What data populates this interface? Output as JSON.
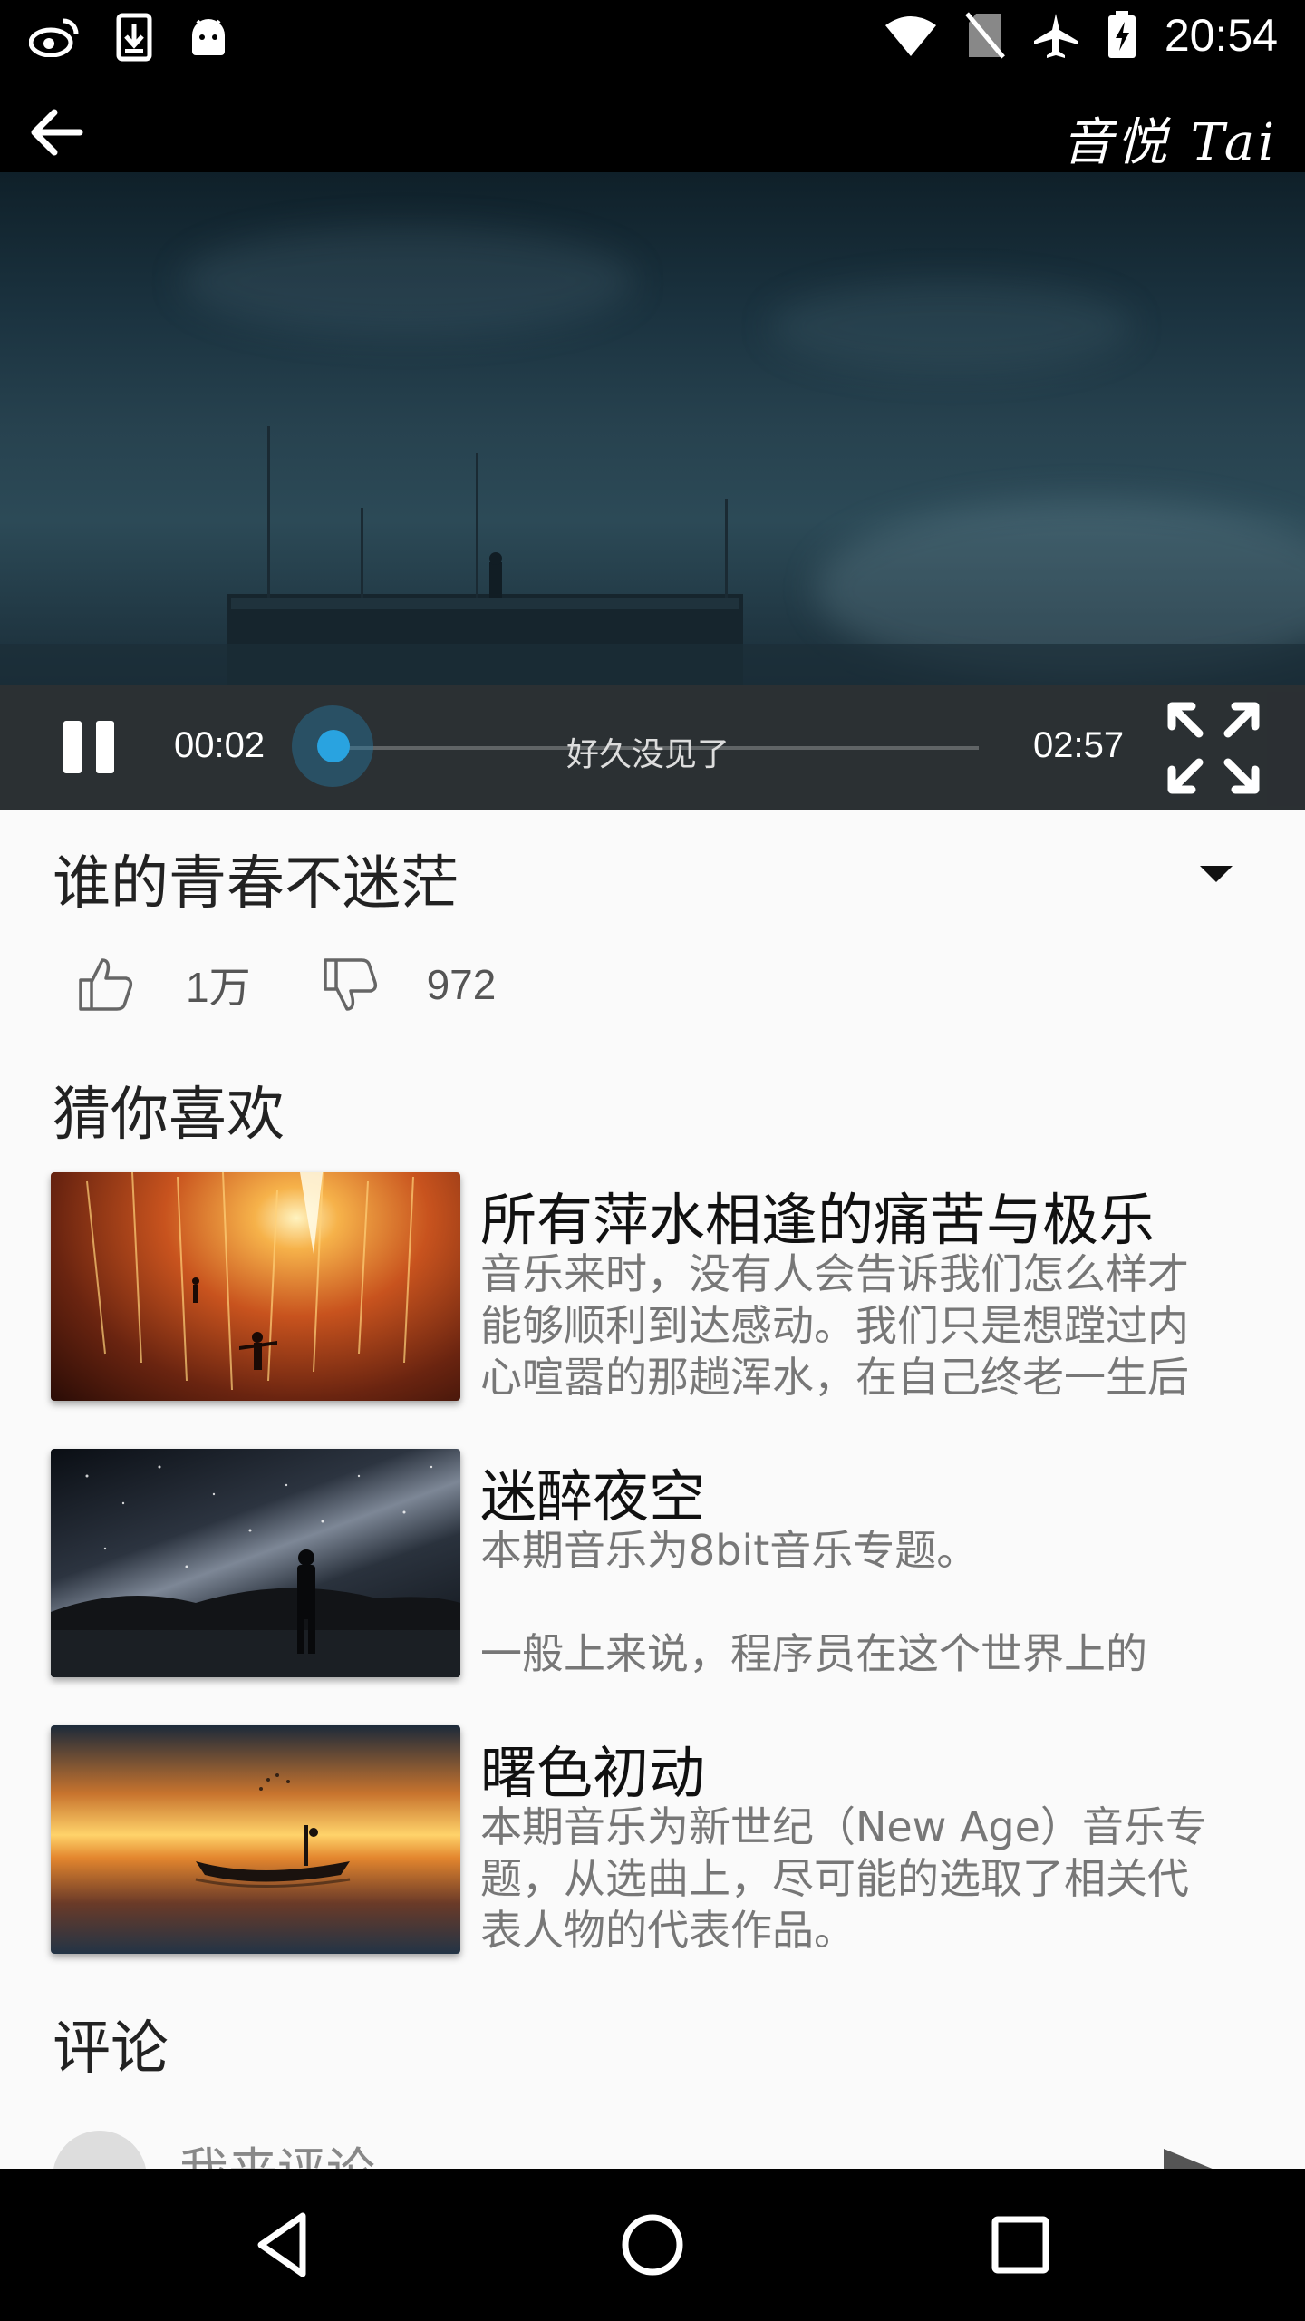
{
  "status_bar": {
    "time": "20:54",
    "left_icons": [
      "weibo-icon",
      "download-icon",
      "android-icon"
    ],
    "right_icons": [
      "wifi-icon",
      "no-sim-icon",
      "airplane-icon",
      "battery-charging-icon"
    ]
  },
  "toolbar": {
    "logo_text": "音悦 Tai"
  },
  "player": {
    "current_time": "00:02",
    "total_time": "02:57",
    "caption": "好久没见了",
    "progress": 0.011,
    "accent": "#29a3e0"
  },
  "video_info": {
    "title": "谁的青春不迷茫",
    "likes": "1万",
    "dislikes": "972"
  },
  "recommendations": {
    "section_title": "猜你喜欢",
    "items": [
      {
        "title": "所有萍水相逢的痛苦与极乐",
        "description": "音乐来时，没有人会告诉我们怎么样才\n能够顺利到达感动。我们只是想蹚过内\n心喧嚣的那趟浑水，在自己终老一生后"
      },
      {
        "title": "迷醉夜空",
        "description": "本期音乐为8bit音乐专题。\n\n一般上来说，程序员在这个世界上的"
      },
      {
        "title": "曙色初动",
        "description": "本期音乐为新世纪（New Age）音乐专\n题，从选曲上，尽可能的选取了相关代\n表人物的代表作品。"
      }
    ]
  },
  "comments": {
    "section_title": "评论",
    "input_placeholder": "我来评论"
  }
}
